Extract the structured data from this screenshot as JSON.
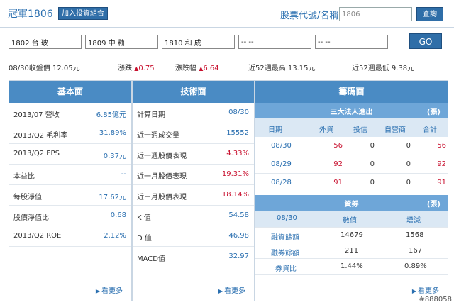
{
  "header": {
    "stock_title": "冠軍1806",
    "add_portfolio_label": "加入投資組合",
    "search_label": "股票代號/名稱",
    "search_value": "1806",
    "query_label": "查詢"
  },
  "compare": {
    "inputs": [
      "1802 台 玻",
      "1809 中 釉",
      "1810 和 成",
      "-- --",
      "-- --"
    ],
    "go_label": "GO"
  },
  "summary": {
    "close": "08/30收盤價 12.05元",
    "change_label": "漲跌",
    "change_value": "0.75",
    "pct_label": "漲跌幅",
    "pct_value": "6.64",
    "high52": "近52週最高 13.15元",
    "low52": "近52週最低 9.38元"
  },
  "fundamentals": {
    "title": "基本面",
    "rows": [
      {
        "label": "2013/07 營收",
        "value": "6.85億元"
      },
      {
        "label": "2013/Q2 毛利率",
        "value": "31.89%"
      },
      {
        "label": "2013/Q2 EPS",
        "value": "0.37元"
      },
      {
        "label": "本益比",
        "value": "--"
      },
      {
        "label": "每股淨值",
        "value": "17.62元"
      },
      {
        "label": "股價淨值比",
        "value": "0.68"
      },
      {
        "label": "2013/Q2 ROE",
        "value": "2.12%"
      }
    ],
    "more_label": "看更多"
  },
  "technical": {
    "title": "技術面",
    "rows": [
      {
        "label": "計算日期",
        "value": "08/30"
      },
      {
        "label": "近一週成交量",
        "value": "15552"
      },
      {
        "label": "近一週股價表現",
        "value": "4.33%"
      },
      {
        "label": "近一月股價表現",
        "value": "19.31%"
      },
      {
        "label": "近三月股價表現",
        "value": "18.14%"
      },
      {
        "label": "K 值",
        "value": "54.58"
      },
      {
        "label": "D 值",
        "value": "46.98"
      },
      {
        "label": "MACD值",
        "value": "32.97"
      }
    ],
    "more_label": "看更多"
  },
  "chips": {
    "title": "籌碼面",
    "institutional": {
      "title": "三大法人進出",
      "unit": "(張)",
      "columns": [
        "日期",
        "外資",
        "投信",
        "自營商",
        "合計"
      ],
      "rows": [
        [
          "08/30",
          "56",
          "0",
          "0",
          "56"
        ],
        [
          "08/29",
          "92",
          "0",
          "0",
          "92"
        ],
        [
          "08/28",
          "91",
          "0",
          "0",
          "91"
        ]
      ]
    },
    "credit": {
      "title": "資券",
      "unit": "(張)",
      "columns": [
        "08/30",
        "數值",
        "增減"
      ],
      "rows": [
        [
          "融資餘額",
          "14679",
          "1568"
        ],
        [
          "融券餘額",
          "211",
          "167"
        ],
        [
          "券資比",
          "1.44%",
          "0.89%"
        ]
      ]
    },
    "more_label": "看更多"
  },
  "watermark": "#888058"
}
